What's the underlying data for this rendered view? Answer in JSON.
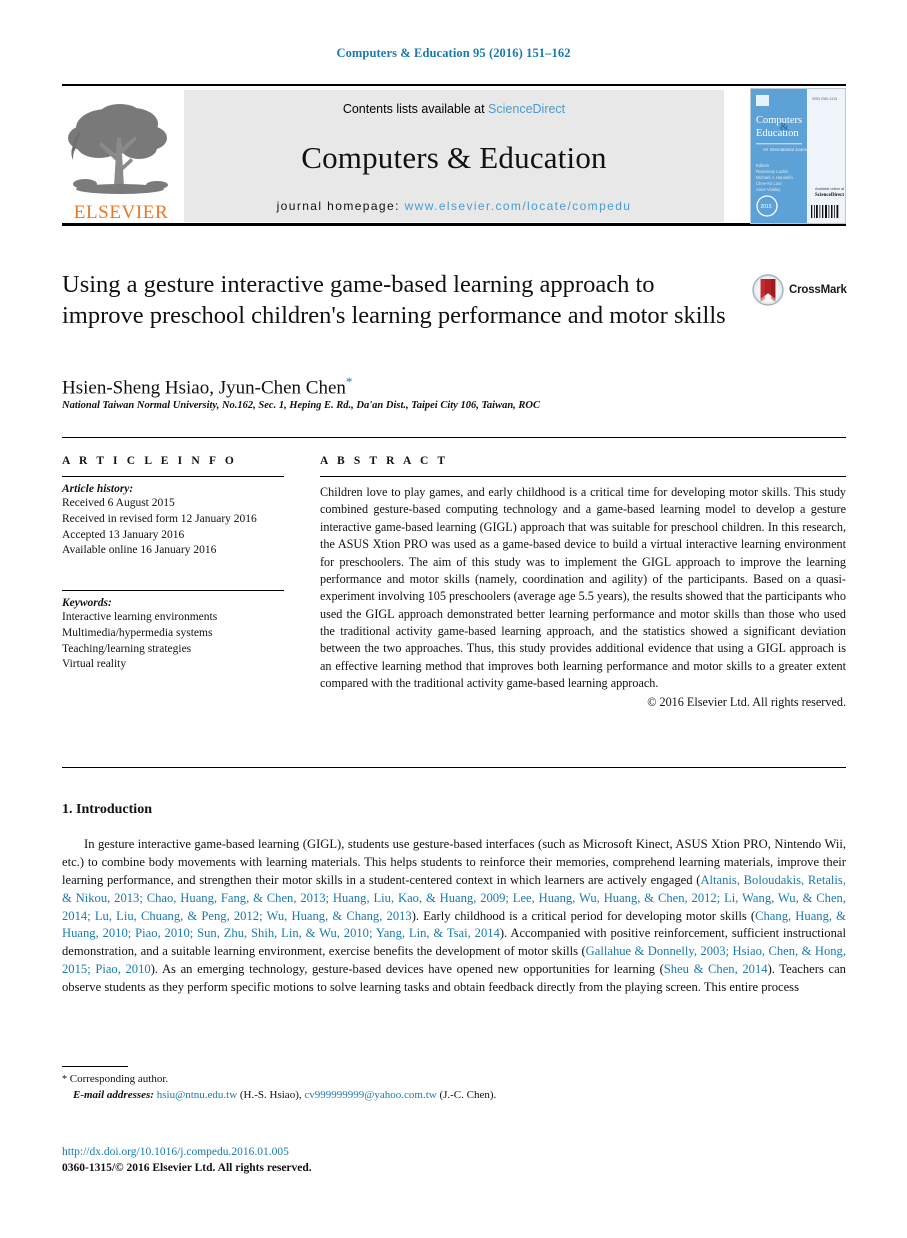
{
  "running_head": "Computers & Education 95 (2016) 151–162",
  "masthead": {
    "publisher_logo_text": "ELSEVIER",
    "contents_prefix": "Contents lists available at ",
    "contents_link": "ScienceDirect",
    "journal_title": "Computers & Education",
    "homepage_prefix": "journal homepage: ",
    "homepage_link": "www.elsevier.com/locate/compedu",
    "cover": {
      "line1": "Computers",
      "line2": "Education",
      "amp": "&",
      "tagline": "An International Journal",
      "editor_label": "Editors",
      "editors": [
        "Rosemary Luckin",
        "Michael J. Hannafin",
        "Chee-Kit Looi",
        "Anne Vinkley"
      ],
      "badge": "2015",
      "issn_label": "ISSN 0360-1315",
      "footer_label": "ScienceDirect"
    }
  },
  "article": {
    "title": "Using a gesture interactive game-based learning approach to improve preschool children's learning performance and motor skills",
    "crossmark_label": "CrossMark",
    "authors": "Hsien-Sheng Hsiao, Jyun-Chen Chen",
    "author_star": "*",
    "affiliation": "National Taiwan Normal University, No.162, Sec. 1, Heping E. Rd., Da'an Dist., Taipei City 106, Taiwan, ROC"
  },
  "info": {
    "heading": "A R T I C L E  I N F O",
    "history_label": "Article history:",
    "history": [
      "Received 6 August 2015",
      "Received in revised form 12 January 2016",
      "Accepted 13 January 2016",
      "Available online 16 January 2016"
    ],
    "keywords_label": "Keywords:",
    "keywords": [
      "Interactive learning environments",
      "Multimedia/hypermedia systems",
      "Teaching/learning strategies",
      "Virtual reality"
    ]
  },
  "abstract": {
    "heading": "A B S T R A C T",
    "body": "Children love to play games, and early childhood is a critical time for developing motor skills. This study combined gesture-based computing technology and a game-based learning model to develop a gesture interactive game-based learning (GIGL) approach that was suitable for preschool children. In this research, the ASUS Xtion PRO was used as a game-based device to build a virtual interactive learning environment for preschoolers. The aim of this study was to implement the GIGL approach to improve the learning performance and motor skills (namely, coordination and agility) of the participants. Based on a quasi-experiment involving 105 preschoolers (average age 5.5 years), the results showed that the participants who used the GIGL approach demonstrated better learning performance and motor skills than those who used the traditional activity game-based learning approach, and the statistics showed a significant deviation between the two approaches. Thus, this study provides additional evidence that using a GIGL approach is an effective learning method that improves both learning performance and motor skills to a greater extent compared with the traditional activity game-based learning approach.",
    "copyright": "© 2016 Elsevier Ltd. All rights reserved."
  },
  "section": {
    "heading": "1. Introduction",
    "paragraph_parts": [
      {
        "type": "text",
        "value": "In gesture interactive game-based learning (GIGL), students use gesture-based interfaces (such as Microsoft Kinect, ASUS Xtion PRO, Nintendo Wii, etc.) to combine body movements with learning materials. This helps students to reinforce their memories, comprehend learning materials, improve their learning performance, and strengthen their motor skills in a student-centered context in which learners are actively engaged ("
      },
      {
        "type": "cite",
        "value": "Altanis, Boloudakis, Retalis, & Nikou, 2013; Chao, Huang, Fang, & Chen, 2013; Huang, Liu, Kao, & Huang, 2009; Lee, Huang, Wu, Huang, & Chen, 2012; Li, Wang, Wu, & Chen, 2014; Lu, Liu, Chuang, & Peng, 2012; Wu, Huang, & Chang, 2013"
      },
      {
        "type": "text",
        "value": "). Early childhood is a critical period for developing motor skills ("
      },
      {
        "type": "cite",
        "value": "Chang, Huang, & Huang, 2010; Piao, 2010; Sun, Zhu, Shih, Lin, & Wu, 2010; Yang, Lin, & Tsai, 2014"
      },
      {
        "type": "text",
        "value": "). Accompanied with positive reinforcement, sufficient instructional demonstration, and a suitable learning environment, exercise benefits the development of motor skills ("
      },
      {
        "type": "cite",
        "value": "Gallahue & Donnelly, 2003; Hsiao, Chen, & Hong, 2015; Piao, 2010"
      },
      {
        "type": "text",
        "value": "). As an emerging technology, gesture-based devices have opened new opportunities for learning ("
      },
      {
        "type": "cite",
        "value": "Sheu & Chen, 2014"
      },
      {
        "type": "text",
        "value": "). Teachers can observe students as they perform specific motions to solve learning tasks and obtain feedback directly from the playing screen. This entire process"
      }
    ]
  },
  "footer": {
    "corresponding_star": "*",
    "corresponding_label": "Corresponding author.",
    "emails_label": "E-mail addresses:",
    "email1": "hsiu@ntnu.edu.tw",
    "email1_owner": "(H.-S. Hsiao)",
    "email2": "cv999999999@yahoo.com.tw",
    "email2_owner": "(J.-C. Chen).",
    "doi": "http://dx.doi.org/10.1016/j.compedu.2016.01.005",
    "issn_line": "0360-1315/© 2016 Elsevier Ltd. All rights reserved."
  },
  "colors": {
    "link_blue": "#1b7aa8",
    "sd_blue": "#4a9ccc",
    "elsevier_orange": "#E87722"
  }
}
